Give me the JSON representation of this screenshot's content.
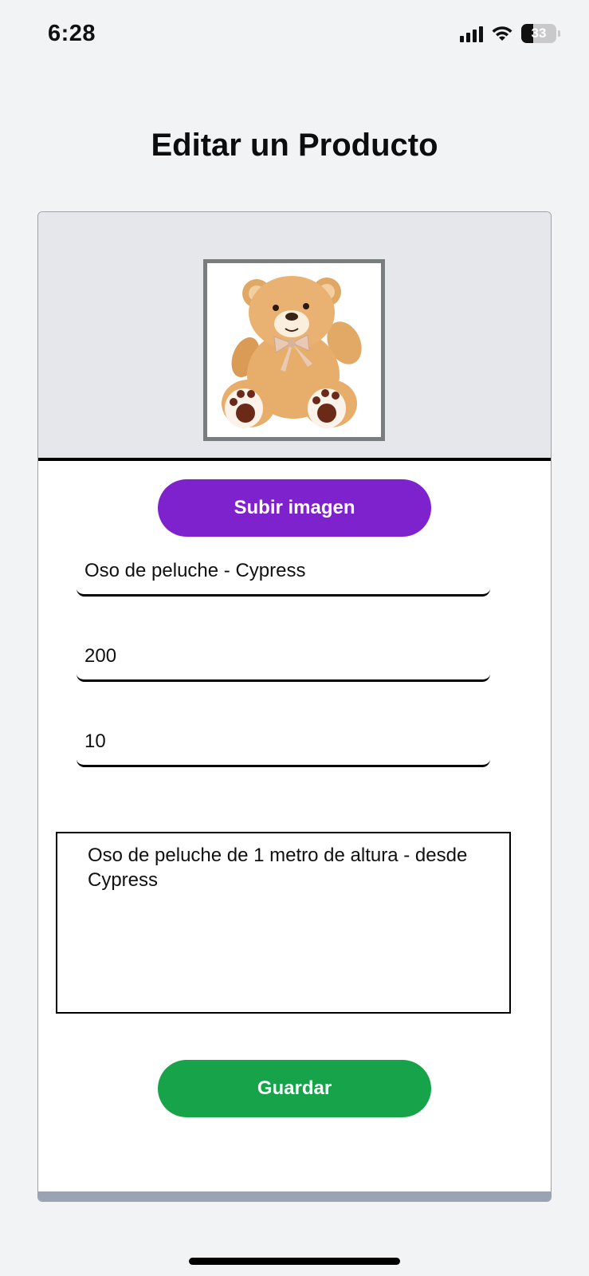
{
  "status_bar": {
    "time": "6:28",
    "battery_level": "33",
    "battery_fraction": 0.33,
    "icons": [
      "signal-icon",
      "wifi-icon",
      "battery-icon"
    ]
  },
  "page": {
    "title": "Editar un Producto"
  },
  "image": {
    "alt": "teddy-bear-product-photo"
  },
  "buttons": {
    "upload_label": "Subir imagen",
    "save_label": "Guardar"
  },
  "form": {
    "name_value": "Oso de peluche - Cypress",
    "price_value": "200",
    "stock_value": "10",
    "description_value": "Oso de peluche de 1 metro de altura - desde Cypress"
  },
  "colors": {
    "upload_button": "#7e22ce",
    "save_button": "#16a34a",
    "image_section_bg": "#e5e7eb",
    "page_bg": "#f2f3f5"
  }
}
